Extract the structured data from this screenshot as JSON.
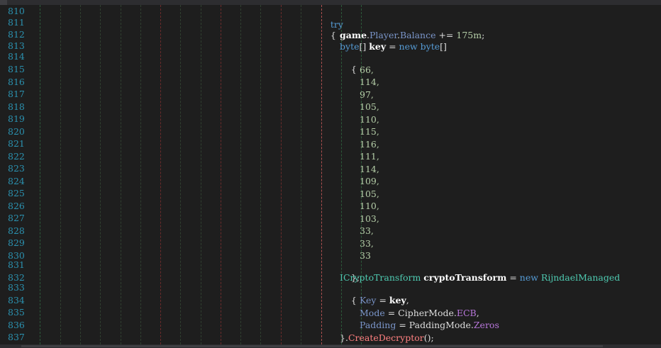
{
  "editor": {
    "line_numbers": [
      "810",
      "811",
      "812",
      "813",
      "814",
      "815",
      "816",
      "817",
      "818",
      "819",
      "820",
      "821",
      "822",
      "823",
      "824",
      "825",
      "826",
      "827",
      "828",
      "829",
      "830",
      "831",
      "832",
      "833",
      "834",
      "835",
      "836",
      "837"
    ],
    "lines": {
      "l810": {
        "kw_try": "try"
      },
      "l811": {
        "brace": "{"
      },
      "l812": {
        "game": "game",
        "dot1": ".",
        "player": "Player",
        "dot2": ".",
        "balance": "Balance",
        "op": " += ",
        "num": "175m",
        "semi": ";"
      },
      "l813": {
        "byte1": "byte",
        "arr": "[] ",
        "key": "key",
        "eq": " = ",
        "new": "new",
        "sp": " ",
        "byte2": "byte",
        "arr2": "[]"
      },
      "l814": {
        "brace": "{"
      },
      "values": [
        "66,",
        "114,",
        "97,",
        "105,",
        "110,",
        "115,",
        "116,",
        "111,",
        "114,",
        "109,",
        "105,",
        "110,",
        "103,",
        "33,",
        "33,",
        "33"
      ],
      "l831": {
        "text": "};"
      },
      "l832": {
        "iface": "ICryptoTransform",
        "sp": " ",
        "var": "cryptoTransform",
        "eq": " = ",
        "new": "new",
        "sp2": " ",
        "cls": "RijndaelManaged"
      },
      "l833": {
        "brace": "{"
      },
      "l834": {
        "prop": "Key",
        "eq": " = ",
        "val": "key",
        "comma": ","
      },
      "l835": {
        "prop": "Mode",
        "eq": " = ",
        "enum": "CipherMode",
        "dot": ".",
        "member": "ECB",
        "comma": ","
      },
      "l836": {
        "prop": "Padding",
        "eq": " = ",
        "enum": "PaddingMode",
        "dot": ".",
        "member": "Zeros"
      },
      "l837": {
        "close": "}",
        "dot": ".",
        "method": "CreateDecryptor",
        "parens": "()",
        "semi": ";"
      }
    },
    "partial_line": "                        .            ,        .       ."
  },
  "colors": {
    "background": "#1e1e1e",
    "line_number": "#2b91af",
    "keyword": "#569cd6",
    "type": "#4ec9b0",
    "number": "#b5cea8",
    "property": "#7a95c9",
    "method": "#ff8080",
    "enum_member": "#b877db"
  }
}
